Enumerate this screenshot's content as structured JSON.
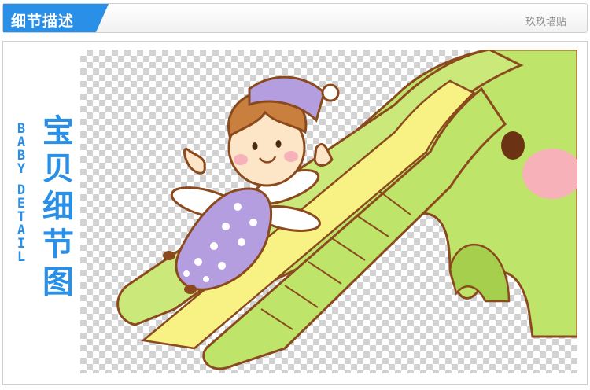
{
  "header": {
    "tab_label": "细节描述",
    "shop_name": "玖玖墙贴"
  },
  "side_label": {
    "english_letters": [
      "B",
      "A",
      "B",
      "Y",
      "",
      "D",
      "E",
      "T",
      "A",
      "I",
      "L"
    ],
    "chinese_chars": [
      "宝",
      "贝",
      "细",
      "节",
      "图"
    ]
  },
  "product_image": {
    "subject": "cartoon fairy girl sliding down green elephant slide",
    "colors": {
      "slide_green": "#bfe46a",
      "slide_yellow": "#f8f285",
      "outline": "#8b4a1e",
      "pajama_purple": "#b59ee0",
      "hair_brown": "#c9803f",
      "cheek_pink": "#f6b2b8"
    }
  }
}
